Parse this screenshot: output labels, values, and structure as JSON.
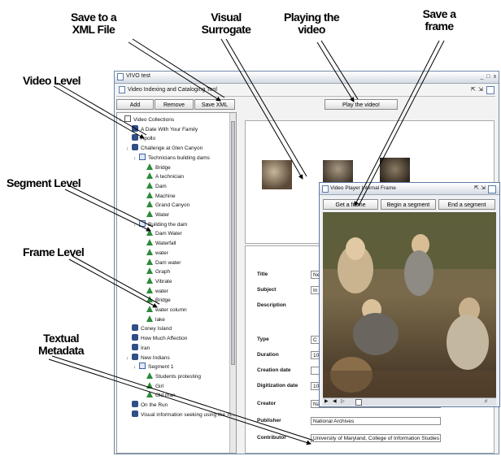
{
  "callouts": {
    "save_xml": [
      "Save to a",
      "XML File"
    ],
    "visual_surrogate": [
      "Visual",
      "Surrogate"
    ],
    "playing_video": [
      "Playing the",
      "video"
    ],
    "save_frame": [
      "Save a",
      "frame"
    ],
    "video_level": "Video Level",
    "segment_level": "Segment Level",
    "frame_level": "Frame Level",
    "textual_metadata": [
      "Textual",
      "Metadata"
    ]
  },
  "window": {
    "title": "VIVO test",
    "controls": [
      "_",
      "□",
      "x"
    ]
  },
  "inner_frame": {
    "title": "Video Indexing and Cataloging Tool"
  },
  "toolbar": {
    "add_label": "Add",
    "remove_label": "Remove",
    "save_xml_label": "Save XML",
    "play_label": "Play the video!"
  },
  "tree": {
    "items": [
      {
        "level": 0,
        "icon": "folder-icon",
        "label": "Video Collections",
        "expander": "↓"
      },
      {
        "level": 1,
        "icon": "film-icon",
        "label": "A Date With Your Family",
        "expander": ""
      },
      {
        "level": 1,
        "icon": "film-icon",
        "label": "Apollo",
        "expander": ""
      },
      {
        "level": 1,
        "icon": "film-icon",
        "label": "Challenge at Glen Canyon",
        "expander": "↓"
      },
      {
        "level": 2,
        "icon": "segment-icon",
        "label": "Technicians building dams",
        "expander": "↓"
      },
      {
        "level": 3,
        "icon": "frame-icon",
        "label": "Bridge",
        "expander": ""
      },
      {
        "level": 3,
        "icon": "frame-icon",
        "label": "A technician",
        "expander": ""
      },
      {
        "level": 3,
        "icon": "frame-icon",
        "label": "Dam",
        "expander": ""
      },
      {
        "level": 3,
        "icon": "frame-icon",
        "label": "Machine",
        "expander": ""
      },
      {
        "level": 3,
        "icon": "frame-icon",
        "label": "Grand Canyon",
        "expander": ""
      },
      {
        "level": 3,
        "icon": "frame-icon",
        "label": "Water",
        "expander": ""
      },
      {
        "level": 2,
        "icon": "segment-icon",
        "label": "Building the dam",
        "expander": "↓"
      },
      {
        "level": 3,
        "icon": "frame-icon",
        "label": "Dam Water",
        "expander": ""
      },
      {
        "level": 3,
        "icon": "frame-icon",
        "label": "Waterfall",
        "expander": ""
      },
      {
        "level": 3,
        "icon": "frame-icon",
        "label": "water",
        "expander": ""
      },
      {
        "level": 3,
        "icon": "frame-icon",
        "label": "Dam water",
        "expander": ""
      },
      {
        "level": 3,
        "icon": "frame-icon",
        "label": "Graph",
        "expander": ""
      },
      {
        "level": 3,
        "icon": "frame-icon",
        "label": "Vibrate",
        "expander": ""
      },
      {
        "level": 3,
        "icon": "frame-icon",
        "label": "water",
        "expander": ""
      },
      {
        "level": 3,
        "icon": "frame-icon",
        "label": "Bridge",
        "expander": ""
      },
      {
        "level": 3,
        "icon": "frame-icon",
        "label": "water column",
        "expander": ""
      },
      {
        "level": 3,
        "icon": "frame-icon",
        "label": "lake",
        "expander": ""
      },
      {
        "level": 1,
        "icon": "film-icon",
        "label": "Coney Island",
        "expander": ""
      },
      {
        "level": 1,
        "icon": "film-icon",
        "label": "How Much Affection",
        "expander": ""
      },
      {
        "level": 1,
        "icon": "film-icon",
        "label": "Iran",
        "expander": ""
      },
      {
        "level": 1,
        "icon": "film-icon",
        "label": "New Indians",
        "expander": "↓"
      },
      {
        "level": 2,
        "icon": "segment-icon",
        "label": "Segment 1",
        "expander": "↓"
      },
      {
        "level": 3,
        "icon": "frame-icon",
        "label": "Students protesting",
        "expander": ""
      },
      {
        "level": 3,
        "icon": "frame-icon",
        "label": "Girl",
        "expander": ""
      },
      {
        "level": 3,
        "icon": "frame-icon",
        "label": "Old man",
        "expander": ""
      },
      {
        "level": 1,
        "icon": "film-icon",
        "label": "On the Run",
        "expander": ""
      },
      {
        "level": 1,
        "icon": "film-icon",
        "label": "Visual information seeking using the Ti...",
        "expander": ""
      }
    ]
  },
  "metadata": {
    "fields": [
      {
        "label": "Title",
        "value": "Ne"
      },
      {
        "label": "Subject",
        "value": "In"
      },
      {
        "label": "Description",
        "value": ""
      },
      {
        "label": "Type",
        "value": "C"
      },
      {
        "label": "Duration",
        "value": "10"
      },
      {
        "label": "Creation date",
        "value": ""
      },
      {
        "label": "Digitization date",
        "value": "10"
      },
      {
        "label": "Creator",
        "value": "National Archives"
      },
      {
        "label": "Publisher",
        "value": "National Archives"
      },
      {
        "label": "Contributor",
        "value": "University of Maryland, College of Information Studies"
      }
    ]
  },
  "video_player": {
    "title": "Video Player Internal Frame",
    "get_frame_label": "Get a frame",
    "begin_segment_label": "Begin a segment",
    "end_segment_label": "End a segment"
  }
}
